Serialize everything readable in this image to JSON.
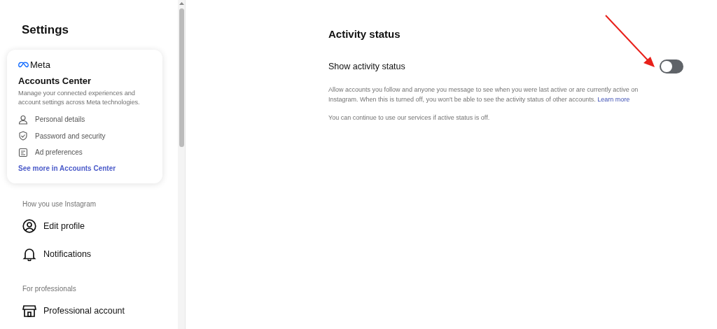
{
  "sidebar": {
    "title": "Settings",
    "accounts_center": {
      "brand": "Meta",
      "title": "Accounts Center",
      "description": "Manage your connected experiences and account settings across Meta technologies.",
      "items": [
        {
          "label": "Personal details"
        },
        {
          "label": "Password and security"
        },
        {
          "label": "Ad preferences"
        }
      ],
      "link": "See more in Accounts Center"
    },
    "sections": [
      {
        "heading": "How you use Instagram",
        "items": [
          {
            "label": "Edit profile"
          },
          {
            "label": "Notifications"
          }
        ]
      },
      {
        "heading": "For professionals",
        "items": [
          {
            "label": "Professional account"
          }
        ]
      }
    ]
  },
  "main": {
    "title": "Activity status",
    "setting": {
      "label": "Show activity status",
      "on": false
    },
    "description": "Allow accounts you follow and anyone you message to see when you were last active or are currently active on Instagram. When this is turned off, you won't be able to see the activity status of other accounts.",
    "link": "Learn more",
    "note": "You can continue to use our services if active status is off."
  }
}
